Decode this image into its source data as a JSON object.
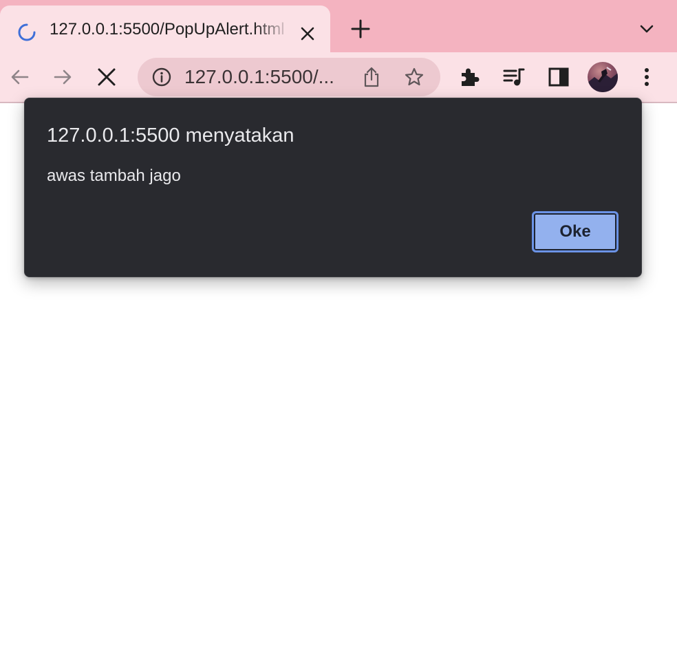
{
  "browser": {
    "tab": {
      "title": "127.0.0.1:5500/PopUpAlert.html",
      "status": "loading"
    },
    "address_bar": {
      "url_display": "127.0.0.1:5500/..."
    },
    "icons": {
      "back": "arrow-left-icon",
      "forward": "arrow-right-icon",
      "stop": "close-icon",
      "site_info": "info-icon",
      "share": "share-icon",
      "bookmark": "star-icon",
      "extensions": "puzzle-icon",
      "media": "media-control-icon",
      "side_panel": "side-panel-icon",
      "menu": "three-dot-menu-icon",
      "new_tab": "plus-icon",
      "tab_search": "chevron-down-icon"
    },
    "colors": {
      "tab_strip": "#f4b3c0",
      "toolbar": "#fbe1e6",
      "spinner": "#3f6fd8"
    }
  },
  "alert": {
    "title": "127.0.0.1:5500 menyatakan",
    "message": "awas tambah jago",
    "ok_label": "Oke",
    "colors": {
      "background": "#292a2f",
      "button": "#93b1ee"
    }
  }
}
